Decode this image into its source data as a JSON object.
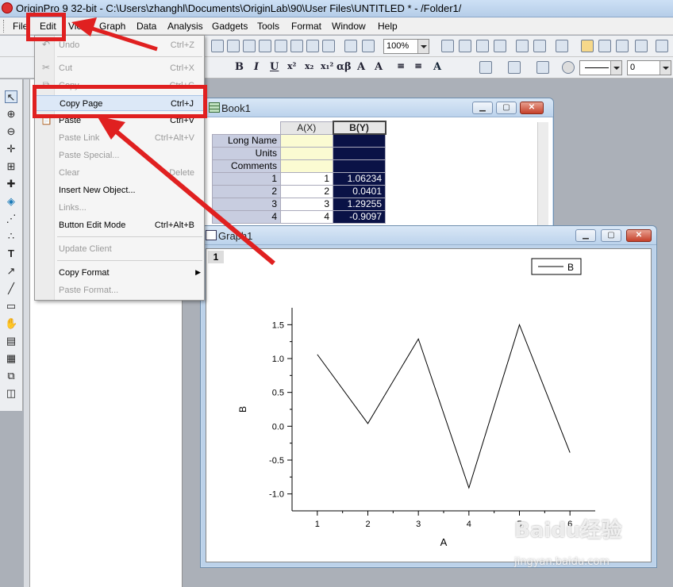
{
  "app_title": "OriginPro 9 32-bit - C:\\Users\\zhanghl\\Documents\\OriginLab\\90\\User Files\\UNTITLED * - /Folder1/",
  "menubar": [
    "File",
    "Edit",
    "View",
    "Graph",
    "Data",
    "Analysis",
    "Gadgets",
    "Tools",
    "Format",
    "Window",
    "Help"
  ],
  "toolbar": {
    "zoom": "100%",
    "line_width": "0"
  },
  "edit_menu": {
    "items": [
      {
        "label": "Undo",
        "shortcut": "Ctrl+Z",
        "enabled": false,
        "icon": "undo-icon"
      },
      {
        "label": "Cut",
        "shortcut": "Ctrl+X",
        "enabled": false,
        "icon": "scissors-icon"
      },
      {
        "label": "Copy",
        "shortcut": "Ctrl+C",
        "enabled": false,
        "icon": "copy-icon"
      },
      {
        "label": "Copy Page",
        "shortcut": "Ctrl+J",
        "enabled": true,
        "highlighted": true
      },
      {
        "label": "Paste",
        "shortcut": "Ctrl+V",
        "enabled": true,
        "icon": "paste-icon"
      },
      {
        "label": "Paste Link",
        "shortcut": "Ctrl+Alt+V",
        "enabled": false
      },
      {
        "label": "Paste Special...",
        "shortcut": "",
        "enabled": false
      },
      {
        "label": "Clear",
        "shortcut": "Delete",
        "enabled": false
      },
      {
        "label": "Insert New Object...",
        "shortcut": "",
        "enabled": true
      },
      {
        "label": "Links...",
        "shortcut": "",
        "enabled": false
      },
      {
        "label": "Button Edit Mode",
        "shortcut": "Ctrl+Alt+B",
        "enabled": true
      },
      {
        "label": "Update Client",
        "shortcut": "",
        "enabled": false
      },
      {
        "label": "Copy Format",
        "shortcut": "",
        "enabled": true,
        "submenu": true
      },
      {
        "label": "Paste Format...",
        "shortcut": "",
        "enabled": false
      }
    ]
  },
  "book": {
    "title": "Book1",
    "columns": [
      "A(X)",
      "B(Y)"
    ],
    "meta_rows": [
      "Long Name",
      "Units",
      "Comments"
    ],
    "rows": [
      {
        "n": "1",
        "a": "1",
        "b": "1.06234"
      },
      {
        "n": "2",
        "a": "2",
        "b": "0.0401"
      },
      {
        "n": "3",
        "a": "3",
        "b": "1.29255"
      },
      {
        "n": "4",
        "a": "4",
        "b": "-0.9097"
      }
    ]
  },
  "graph": {
    "title": "Graph1",
    "layer": "1"
  },
  "chart_data": {
    "type": "line",
    "x": [
      1,
      2,
      3,
      4,
      5,
      6
    ],
    "series": [
      {
        "name": "B",
        "values": [
          1.06,
          0.04,
          1.29,
          -0.91,
          1.5,
          -0.39
        ]
      }
    ],
    "xlabel": "A",
    "ylabel": "B",
    "xlim": [
      0.5,
      6.5
    ],
    "ylim": [
      -1.25,
      1.75
    ],
    "xticks": [
      "1",
      "2",
      "3",
      "4",
      "5",
      "6"
    ],
    "yticks": [
      "-1.0",
      "-0.5",
      "0.0",
      "0.5",
      "1.0",
      "1.5"
    ],
    "legend": "top-right",
    "grid": false
  },
  "watermark": {
    "logo": "Baidu经验",
    "url": "jingyan.baidu.com"
  },
  "colors": {
    "highlight_box": "#e02020",
    "selected_column": "#0a1246"
  }
}
